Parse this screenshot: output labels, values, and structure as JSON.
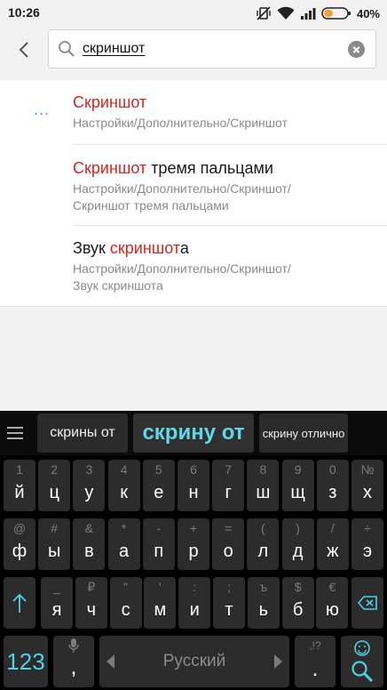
{
  "status": {
    "time": "10:26",
    "battery_percent": "40%",
    "battery_level": 0.4,
    "icons": [
      "mute-vibrate-icon",
      "wifi-icon",
      "signal-icon",
      "battery-icon"
    ]
  },
  "search": {
    "query": "скриншот",
    "icons": [
      "back-arrow-icon",
      "search-icon",
      "clear-icon"
    ]
  },
  "results": [
    {
      "title_pre": "",
      "title_hl": "Скриншот",
      "title_post": "",
      "path_line1": "Настройки/Дополнительно/Скриншот",
      "path_line2": ""
    },
    {
      "title_pre": "",
      "title_hl": "Скриншот",
      "title_post": " тремя пальцами",
      "path_line1": "Настройки/Дополнительно/Скриншот/",
      "path_line2": "Скриншот тремя пальцами"
    },
    {
      "title_pre": "Звук ",
      "title_hl": "скриншот",
      "title_post": "а",
      "path_line1": "Настройки/Дополнительно/Скриншот/",
      "path_line2": "Звук скриншота"
    }
  ],
  "more_indicator": "...",
  "colors": {
    "highlight": "#d9251d",
    "accent": "#4fd0e3",
    "dots": "#3a9ad9"
  },
  "keyboard": {
    "suggestions": [
      "скрины от",
      "скрину от",
      "скрину отлично"
    ],
    "row1": [
      {
        "hint": "1",
        "main": "й"
      },
      {
        "hint": "2",
        "main": "ц"
      },
      {
        "hint": "3",
        "main": "у"
      },
      {
        "hint": "4",
        "main": "к"
      },
      {
        "hint": "5",
        "main": "е"
      },
      {
        "hint": "6",
        "main": "н"
      },
      {
        "hint": "7",
        "main": "г"
      },
      {
        "hint": "8",
        "main": "ш"
      },
      {
        "hint": "9",
        "main": "щ"
      },
      {
        "hint": "0",
        "main": "з"
      },
      {
        "hint": "№",
        "main": "х"
      }
    ],
    "row2": [
      {
        "hint": "@",
        "main": "ф"
      },
      {
        "hint": "#",
        "main": "ы"
      },
      {
        "hint": "&",
        "main": "в"
      },
      {
        "hint": "*",
        "main": "а"
      },
      {
        "hint": "-",
        "main": "п"
      },
      {
        "hint": "+",
        "main": "р"
      },
      {
        "hint": "=",
        "main": "о"
      },
      {
        "hint": "(",
        "main": "л"
      },
      {
        "hint": ")",
        "main": "д"
      },
      {
        "hint": "/",
        "main": "ж"
      },
      {
        "hint": "÷",
        "main": "э"
      }
    ],
    "row3": [
      {
        "hint": "_",
        "main": "я"
      },
      {
        "hint": "₽",
        "main": "ч"
      },
      {
        "hint": "\"",
        "main": "с"
      },
      {
        "hint": "'",
        "main": "м"
      },
      {
        "hint": ":",
        "main": "и"
      },
      {
        "hint": ";",
        "main": "т"
      },
      {
        "hint": "ъ",
        "main": "ь"
      },
      {
        "hint": "$",
        "main": "б"
      },
      {
        "hint": "€",
        "main": "ю"
      }
    ],
    "bottom": {
      "numbers": "123",
      "comma": ",",
      "space_lang": "Русский",
      "period_hint": ",!?",
      "period": "."
    }
  }
}
